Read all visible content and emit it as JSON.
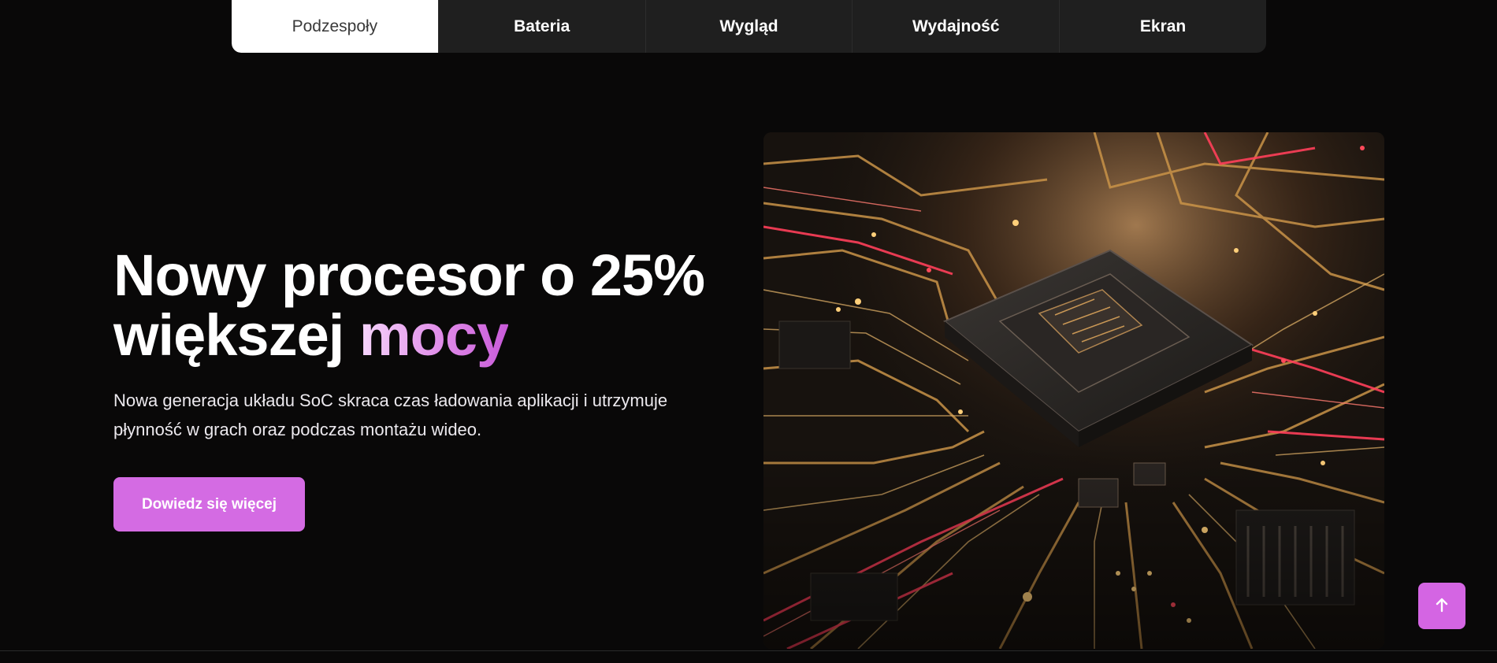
{
  "tabs": [
    {
      "label": "Podzespoły",
      "active": true
    },
    {
      "label": "Bateria",
      "active": false
    },
    {
      "label": "Wygląd",
      "active": false
    },
    {
      "label": "Wydajność",
      "active": false
    },
    {
      "label": "Ekran",
      "active": false
    }
  ],
  "hero": {
    "headline_line1": "Nowy procesor o 25%",
    "headline_line2_plain": "większej",
    "headline_line2_accent": "mocy",
    "description_line1": "Nowa generacja układu SoC skraca czas ładowania aplikacji i utrzymuje",
    "description_line2": "płynność w grach oraz podczas montażu wideo.",
    "cta_label": "Dowiedz się więcej"
  },
  "icons": {
    "back_to_top": "arrow-up-icon"
  },
  "colors": {
    "background": "#090808",
    "accent": "#d46be3",
    "tab_bar": "#1f1f1f"
  }
}
